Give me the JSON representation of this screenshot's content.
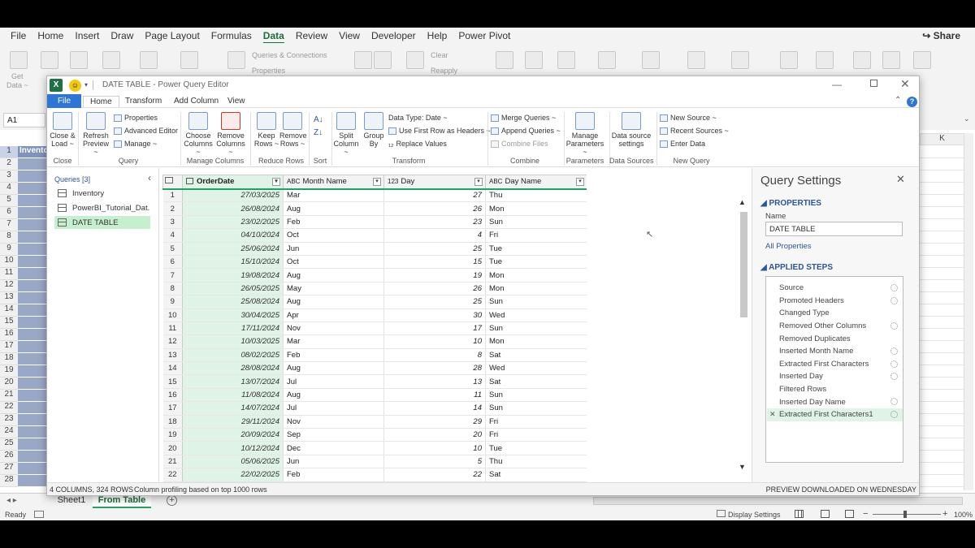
{
  "excel": {
    "menu": [
      "File",
      "Home",
      "Insert",
      "Draw",
      "Page Layout",
      "Formulas",
      "Data",
      "Review",
      "View",
      "Developer",
      "Help",
      "Power Pivot"
    ],
    "active_menu": "Data",
    "share_label": "Share",
    "ghost_labels": {
      "get_data": "Get",
      "data": "Data ~",
      "queries_connections": "Queries & Connections",
      "properties": "Properties",
      "clear": "Clear",
      "reapply": "Reapply"
    },
    "name_box": "A1",
    "col_k": "K",
    "row_numbers": [
      "1",
      "2",
      "3",
      "4",
      "5",
      "6",
      "7",
      "8",
      "9",
      "10",
      "11",
      "12",
      "13",
      "14",
      "15",
      "16",
      "17",
      "18",
      "19",
      "20",
      "21",
      "22",
      "23",
      "24",
      "25",
      "26",
      "27",
      "28"
    ],
    "cell_a1": "Invento",
    "sheet_tabs": [
      "Sheet1",
      "From Table"
    ],
    "active_sheet": "From Table",
    "status": {
      "ready": "Ready",
      "display_settings": "Display Settings",
      "zoom": "100%"
    }
  },
  "pq": {
    "title": "DATE TABLE - Power Query Editor",
    "tabs": [
      "File",
      "Home",
      "Transform",
      "Add Column",
      "View"
    ],
    "active_tab": "Home",
    "ribbon": {
      "close_load": [
        "Close &",
        "Load ~"
      ],
      "refresh": [
        "Refresh",
        "Preview ~"
      ],
      "properties": "Properties",
      "advanced_editor": "Advanced Editor",
      "manage": "Manage ~",
      "choose_columns": [
        "Choose",
        "Columns ~"
      ],
      "remove_columns": [
        "Remove",
        "Columns ~"
      ],
      "keep_rows": [
        "Keep",
        "Rows ~"
      ],
      "remove_rows": [
        "Remove",
        "Rows ~"
      ],
      "split_column": [
        "Split",
        "Column ~"
      ],
      "group_by": [
        "Group",
        "By"
      ],
      "data_type": "Data Type: Date ~",
      "use_first_row": "Use First Row as Headers ~",
      "replace_values": "Replace Values",
      "merge_queries": "Merge Queries ~",
      "append_queries": "Append Queries ~",
      "combine_files": "Combine Files",
      "manage_parameters": [
        "Manage",
        "Parameters ~"
      ],
      "data_source_settings": [
        "Data source",
        "settings"
      ],
      "new_source": "New Source ~",
      "recent_sources": "Recent Sources ~",
      "enter_data": "Enter Data",
      "groups": [
        "Close",
        "Query",
        "Manage Columns",
        "Reduce Rows",
        "Sort",
        "Transform",
        "Combine",
        "Parameters",
        "Data Sources",
        "New Query"
      ]
    },
    "queries_header": "Queries [3]",
    "queries": [
      "Inventory",
      "PowerBI_Tutorial_Dat...",
      "DATE TABLE"
    ],
    "selected_query": "DATE TABLE",
    "columns": [
      {
        "type": "calendar",
        "name": "OrderDate"
      },
      {
        "type": "ABC",
        "name": "Month Name"
      },
      {
        "type": "123",
        "name": "Day"
      },
      {
        "type": "ABC",
        "name": "Day Name"
      }
    ],
    "rows": [
      [
        "1",
        "27/03/2025",
        "Mar",
        "27",
        "Thu"
      ],
      [
        "2",
        "26/08/2024",
        "Aug",
        "26",
        "Mon"
      ],
      [
        "3",
        "23/02/2025",
        "Feb",
        "23",
        "Sun"
      ],
      [
        "4",
        "04/10/2024",
        "Oct",
        "4",
        "Fri"
      ],
      [
        "5",
        "25/06/2024",
        "Jun",
        "25",
        "Tue"
      ],
      [
        "6",
        "15/10/2024",
        "Oct",
        "15",
        "Tue"
      ],
      [
        "7",
        "19/08/2024",
        "Aug",
        "19",
        "Mon"
      ],
      [
        "8",
        "26/05/2025",
        "May",
        "26",
        "Mon"
      ],
      [
        "9",
        "25/08/2024",
        "Aug",
        "25",
        "Sun"
      ],
      [
        "10",
        "30/04/2025",
        "Apr",
        "30",
        "Wed"
      ],
      [
        "11",
        "17/11/2024",
        "Nov",
        "17",
        "Sun"
      ],
      [
        "12",
        "10/03/2025",
        "Mar",
        "10",
        "Mon"
      ],
      [
        "13",
        "08/02/2025",
        "Feb",
        "8",
        "Sat"
      ],
      [
        "14",
        "28/08/2024",
        "Aug",
        "28",
        "Wed"
      ],
      [
        "15",
        "13/07/2024",
        "Jul",
        "13",
        "Sat"
      ],
      [
        "16",
        "11/08/2024",
        "Aug",
        "11",
        "Sun"
      ],
      [
        "17",
        "14/07/2024",
        "Jul",
        "14",
        "Sun"
      ],
      [
        "18",
        "29/11/2024",
        "Nov",
        "29",
        "Fri"
      ],
      [
        "19",
        "20/09/2024",
        "Sep",
        "20",
        "Fri"
      ],
      [
        "20",
        "10/12/2024",
        "Dec",
        "10",
        "Tue"
      ],
      [
        "21",
        "05/06/2025",
        "Jun",
        "5",
        "Thu"
      ],
      [
        "22",
        "22/02/2025",
        "Feb",
        "22",
        "Sat"
      ]
    ],
    "query_settings": {
      "title": "Query Settings",
      "properties_header": "PROPERTIES",
      "name_label": "Name",
      "name_value": "DATE TABLE",
      "all_properties": "All Properties",
      "applied_steps_header": "APPLIED STEPS",
      "steps": [
        "Source",
        "Promoted Headers",
        "Changed Type",
        "Removed Other Columns",
        "Removed Duplicates",
        "Inserted Month Name",
        "Extracted First Characters",
        "Inserted Day",
        "Filtered Rows",
        "Inserted Day Name",
        "Extracted First Characters1"
      ],
      "selected_step": "Extracted First Characters1"
    },
    "status_left": "4 COLUMNS, 324 ROWS",
    "status_profile": "Column profiling based on top 1000 rows",
    "status_right": "PREVIEW DOWNLOADED ON WEDNESDAY"
  },
  "colors": {
    "excel_green": "#21a366",
    "selected_query": "#c6efce",
    "step_selected": "#dff3e6",
    "file_tab": "#2e75d6"
  }
}
